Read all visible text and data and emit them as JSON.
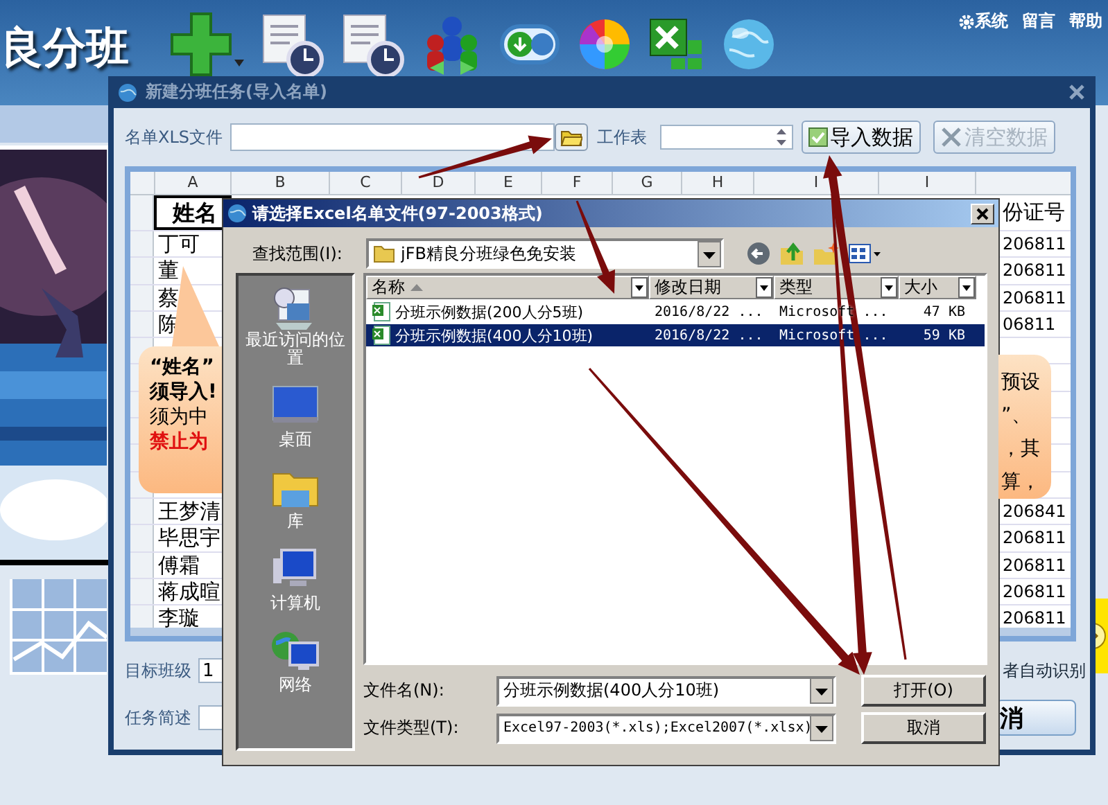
{
  "app": {
    "title": "良分班",
    "menu": [
      "系统",
      "留言",
      "帮助"
    ]
  },
  "import_dialog": {
    "title": "新建分班任务(导入名单)",
    "file_label": "名单XLS文件",
    "sheet_label": "工作表",
    "import_button": {
      "label": "导入数据",
      "disabled": false
    },
    "clear_button": {
      "label": "清空数据",
      "disabled": true
    },
    "grid": {
      "columns": [
        "A",
        "B",
        "C",
        "D",
        "E",
        "F",
        "G",
        "H",
        "I",
        "I"
      ],
      "name_header": "姓名",
      "id_header": "份证号",
      "rows": [
        {
          "name": "丁可",
          "id": "206811"
        },
        {
          "name": "董",
          "id": "206811"
        },
        {
          "name": "蔡",
          "id": "206811"
        },
        {
          "name": "陈",
          "id": "06811"
        },
        {},
        {},
        {},
        {},
        {},
        {},
        {
          "name": "王梦清",
          "id": "206841"
        },
        {
          "name": "毕思宇",
          "id": "206811"
        },
        {
          "name": "傅霜",
          "id": "206811"
        },
        {
          "name": "蒋成暄",
          "id": "206811"
        },
        {
          "name": "李璇",
          "id": "206811"
        }
      ]
    },
    "name_callout": [
      {
        "text": "“姓名”",
        "kind": "bold"
      },
      {
        "text": "须导入!",
        "kind": "bold"
      },
      {
        "text": "须为中",
        "kind": "plain"
      },
      {
        "text": "禁止为",
        "kind": "warning"
      }
    ],
    "side_callout": [
      "预设",
      "”、",
      "，其",
      "算，"
    ],
    "target_label": "目标班级",
    "target_value": "1",
    "task_label": "任务简述",
    "auto_text": "者自动识别",
    "cancel_label": "消"
  },
  "file_dialog": {
    "title": "请选择Excel名单文件(97-2003格式)",
    "look_in_label": "查找范围(I):",
    "look_in_value": "jFB精良分班绿色免安装",
    "places": [
      {
        "label": "最近访问的位置",
        "kind": "recent"
      },
      {
        "label": "桌面",
        "kind": "desktop"
      },
      {
        "label": "库",
        "kind": "library"
      },
      {
        "label": "计算机",
        "kind": "computer"
      },
      {
        "label": "网络",
        "kind": "network"
      }
    ],
    "columns": [
      "名称",
      "修改日期",
      "类型",
      "大小"
    ],
    "files": [
      {
        "name": "分班示例数据(200人分5班)",
        "modified": "2016/8/22 ...",
        "type": "Microsoft ...",
        "size": "47 KB",
        "selected": false
      },
      {
        "name": "分班示例数据(400人分10班)",
        "modified": "2016/8/22 ...",
        "type": "Microsoft ...",
        "size": "59 KB",
        "selected": true
      }
    ],
    "filename_label": "文件名(N):",
    "filename_value": "分班示例数据(400人分10班)",
    "filetype_label": "文件类型(T):",
    "filetype_value": "Excel97-2003(*.xls);Excel2007(*.xlsx)",
    "open_button": "打开(O)",
    "cancel_button": "取消"
  }
}
